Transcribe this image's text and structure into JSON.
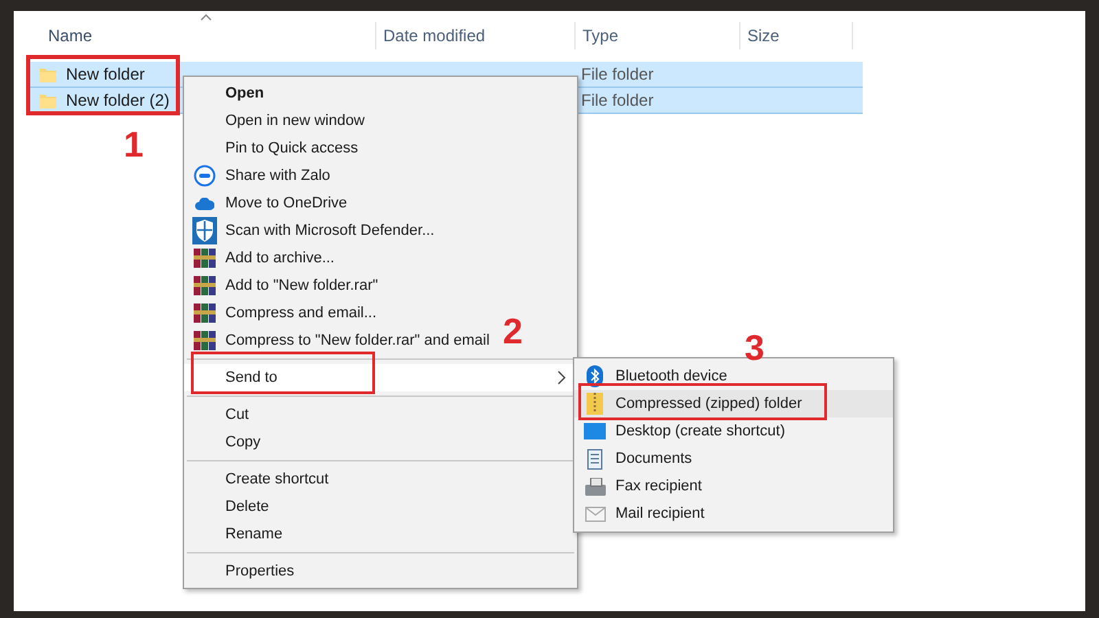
{
  "columns": [
    {
      "label": "Name",
      "sorted": true
    },
    {
      "label": "Date modified",
      "sorted": false
    },
    {
      "label": "Type",
      "sorted": false
    },
    {
      "label": "Size",
      "sorted": false
    }
  ],
  "files": [
    {
      "name": "New folder",
      "type": "File folder",
      "selected": true
    },
    {
      "name": "New folder (2)",
      "type": "File folder",
      "selected": true
    }
  ],
  "context_menu": {
    "items": [
      {
        "kind": "item",
        "label": "Open",
        "default": true
      },
      {
        "kind": "item",
        "label": "Open in new window",
        "default": false
      },
      {
        "kind": "item",
        "label": "Pin to Quick access",
        "default": false
      },
      {
        "kind": "item",
        "label": "Share with Zalo",
        "default": false
      },
      {
        "kind": "item",
        "label": "Move to OneDrive",
        "default": false
      },
      {
        "kind": "item",
        "label": "Scan with Microsoft Defender...",
        "default": false
      },
      {
        "kind": "item",
        "label": "Add to archive...",
        "default": false
      },
      {
        "kind": "item",
        "label": "Add to \"New folder.rar\"",
        "default": false
      },
      {
        "kind": "item",
        "label": "Compress and email...",
        "default": false
      },
      {
        "kind": "item",
        "label": "Compress to \"New folder.rar\" and email",
        "default": false
      },
      {
        "kind": "separator"
      },
      {
        "kind": "submenu",
        "label": "Send to",
        "expanded": true
      },
      {
        "kind": "separator"
      },
      {
        "kind": "item",
        "label": "Cut",
        "default": false
      },
      {
        "kind": "item",
        "label": "Copy",
        "default": false
      },
      {
        "kind": "separator"
      },
      {
        "kind": "item",
        "label": "Create shortcut",
        "default": false
      },
      {
        "kind": "item",
        "label": "Delete",
        "default": false
      },
      {
        "kind": "item",
        "label": "Rename",
        "default": false
      },
      {
        "kind": "separator"
      },
      {
        "kind": "item",
        "label": "Properties",
        "default": false
      }
    ]
  },
  "send_to_menu": {
    "items": [
      {
        "label": "Bluetooth device",
        "selected": false
      },
      {
        "label": "Compressed (zipped) folder",
        "selected": true
      },
      {
        "label": "Desktop (create shortcut)",
        "selected": false
      },
      {
        "label": "Documents",
        "selected": false
      },
      {
        "label": "Fax recipient",
        "selected": false
      },
      {
        "label": "Mail recipient",
        "selected": false
      }
    ]
  },
  "annotations": [
    {
      "label": "1"
    },
    {
      "label": "2"
    },
    {
      "label": "3"
    }
  ]
}
